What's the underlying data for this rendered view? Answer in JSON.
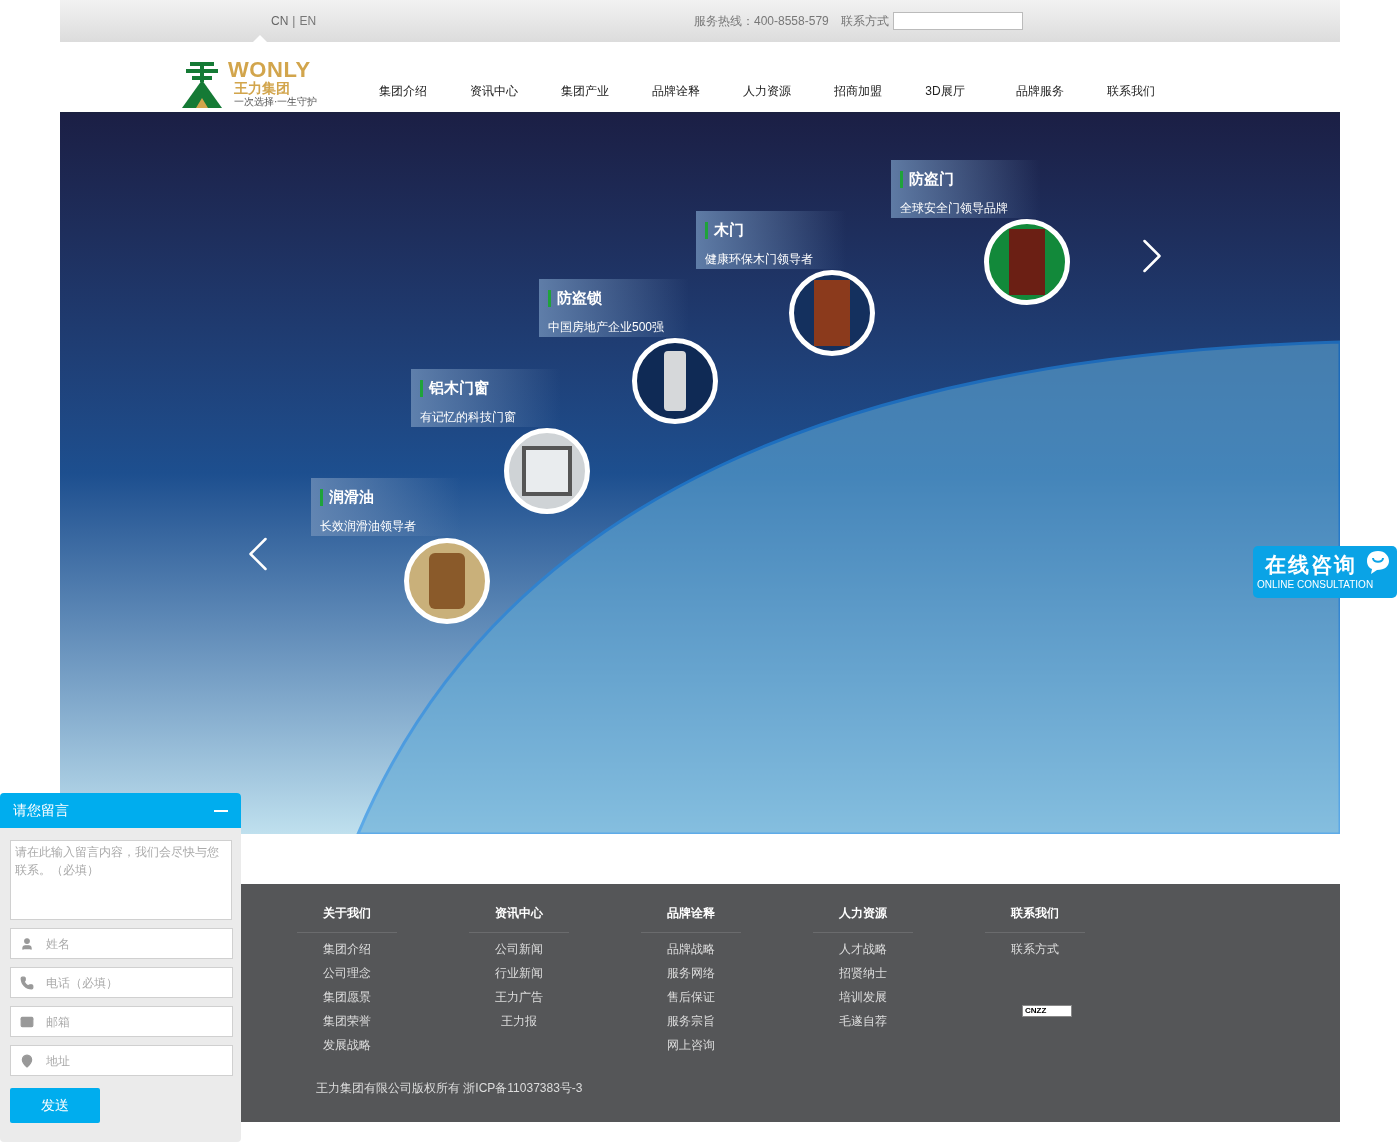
{
  "top_bar": {
    "languages": [
      {
        "label": "CN",
        "selected": true
      },
      {
        "label": "EN",
        "selected": false
      }
    ],
    "language_separator": "|",
    "hotline": "服务热线：400-8558-579",
    "contact_label": "联系方式"
  },
  "logo": {
    "name": "WONLY",
    "chinese": "王力集团",
    "slogan": "一次选择·一生守护"
  },
  "nav": [
    "集团介绍",
    "资讯中心",
    "集团产业",
    "品牌诠释",
    "人力资源",
    "招商加盟",
    "3D展厅",
    "品牌服务",
    "联系我们"
  ],
  "banner": {
    "products": [
      {
        "title": "润滑油",
        "subtitle": "长效润滑油领导者",
        "kind": "oil"
      },
      {
        "title": "铝木门窗",
        "subtitle": "有记忆的科技门窗",
        "kind": "window"
      },
      {
        "title": "防盗锁",
        "subtitle": "中国房地产企业500强",
        "kind": "lock"
      },
      {
        "title": "木门",
        "subtitle": "健康环保木门领导者",
        "kind": "wood-door"
      },
      {
        "title": "防盗门",
        "subtitle": "全球安全门领导品牌",
        "kind": "steel-door"
      }
    ]
  },
  "online_consult": {
    "title": "在线咨询",
    "subtitle": "ONLINE CONSULTATION"
  },
  "footer": {
    "columns": [
      {
        "heading": "关于我们",
        "links": [
          "集团介绍",
          "公司理念",
          "集团愿景",
          "集团荣誉",
          "发展战略"
        ]
      },
      {
        "heading": "资讯中心",
        "links": [
          "公司新闻",
          "行业新闻",
          "王力广告",
          "王力报"
        ]
      },
      {
        "heading": "品牌诠释",
        "links": [
          "品牌战略",
          "服务网络",
          "售后保证",
          "服务宗旨",
          "网上咨询"
        ]
      },
      {
        "heading": "人力资源",
        "links": [
          "人才战略",
          "招贤纳士",
          "培训发展",
          "毛遂自荐"
        ]
      },
      {
        "heading": "联系我们",
        "links": [
          "联系方式"
        ]
      }
    ],
    "stats_badge": "CNZZ",
    "copyright": "王力集团有限公司版权所有 浙ICP备11037383号-3"
  },
  "message_form": {
    "title": "请您留言",
    "message_placeholder": "请在此输入留言内容，我们会尽快与您联系。（必填）",
    "fields": [
      {
        "kind": "name",
        "placeholder": "姓名"
      },
      {
        "kind": "phone",
        "placeholder": "电话（必填）"
      },
      {
        "kind": "email",
        "placeholder": "邮箱"
      },
      {
        "kind": "address",
        "placeholder": "地址"
      }
    ],
    "submit": "发送"
  }
}
